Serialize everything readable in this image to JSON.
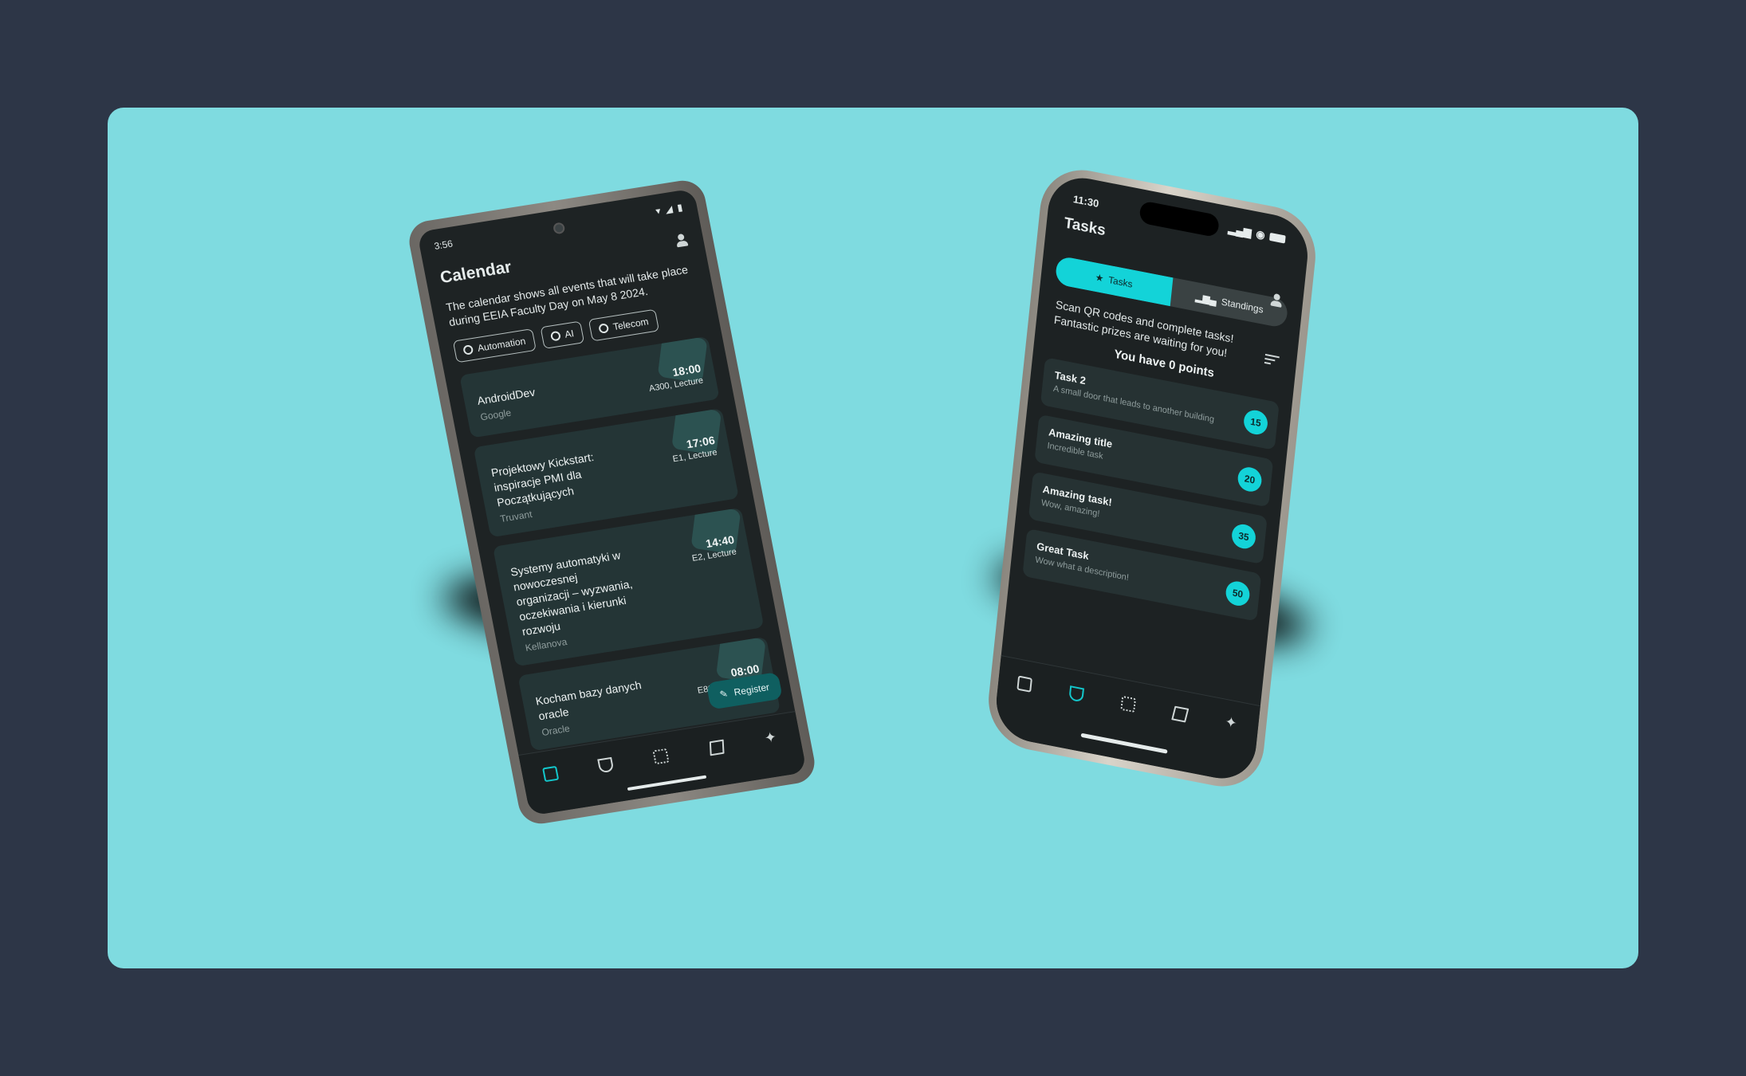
{
  "android": {
    "status": {
      "time": "3:56"
    },
    "title": "Calendar",
    "description": "The calendar shows all events that will take place during EEIA Faculty Day on May 8 2024.",
    "chips": [
      {
        "label": "Automation",
        "icon": "robot-icon"
      },
      {
        "label": "AI",
        "icon": "brain-icon"
      },
      {
        "label": "Telecom",
        "icon": "antenna-icon"
      }
    ],
    "events": [
      {
        "name": "AndroidDev",
        "org": "Google",
        "time": "18:00",
        "location": "A300, Lecture"
      },
      {
        "name": "Projektowy Kickstart: inspiracje PMI dla Początkujących",
        "org": "Truvant",
        "time": "17:06",
        "location": "E1, Lecture"
      },
      {
        "name": "Systemy automatyki w nowoczesnej organizacji – wyzwania, oczekiwania i kierunki rozwoju",
        "org": "Kellanova",
        "time": "14:40",
        "location": "E2, Lecture"
      },
      {
        "name": "Kocham bazy danych oracle",
        "org": "Oracle",
        "time": "08:00",
        "location": "E800, Workshop"
      }
    ],
    "fab_label": "Register",
    "accent": "#13c7cc"
  },
  "iphone": {
    "status": {
      "time": "11:30"
    },
    "title": "Tasks",
    "tabs": [
      {
        "label": "Tasks",
        "icon": "star-icon",
        "selected": true
      },
      {
        "label": "Standings",
        "icon": "bar-chart-icon",
        "selected": false
      }
    ],
    "description": "Scan QR codes and complete tasks! Fantastic prizes are waiting for you!",
    "points_text": "You have 0 points",
    "tasks": [
      {
        "title": "Task 2",
        "desc": "A small door that leads to another building",
        "points": "15"
      },
      {
        "title": "Amazing title",
        "desc": "Incredible task",
        "points": "20"
      },
      {
        "title": "Amazing task!",
        "desc": "Wow, amazing!",
        "points": "35"
      },
      {
        "title": "Great Task",
        "desc": "Wow what a description!",
        "points": "50"
      }
    ],
    "accent": "#13d3d8"
  },
  "colors": {
    "background": "#2d3647",
    "card": "#7fdbe0",
    "screen": "#1e2324"
  }
}
